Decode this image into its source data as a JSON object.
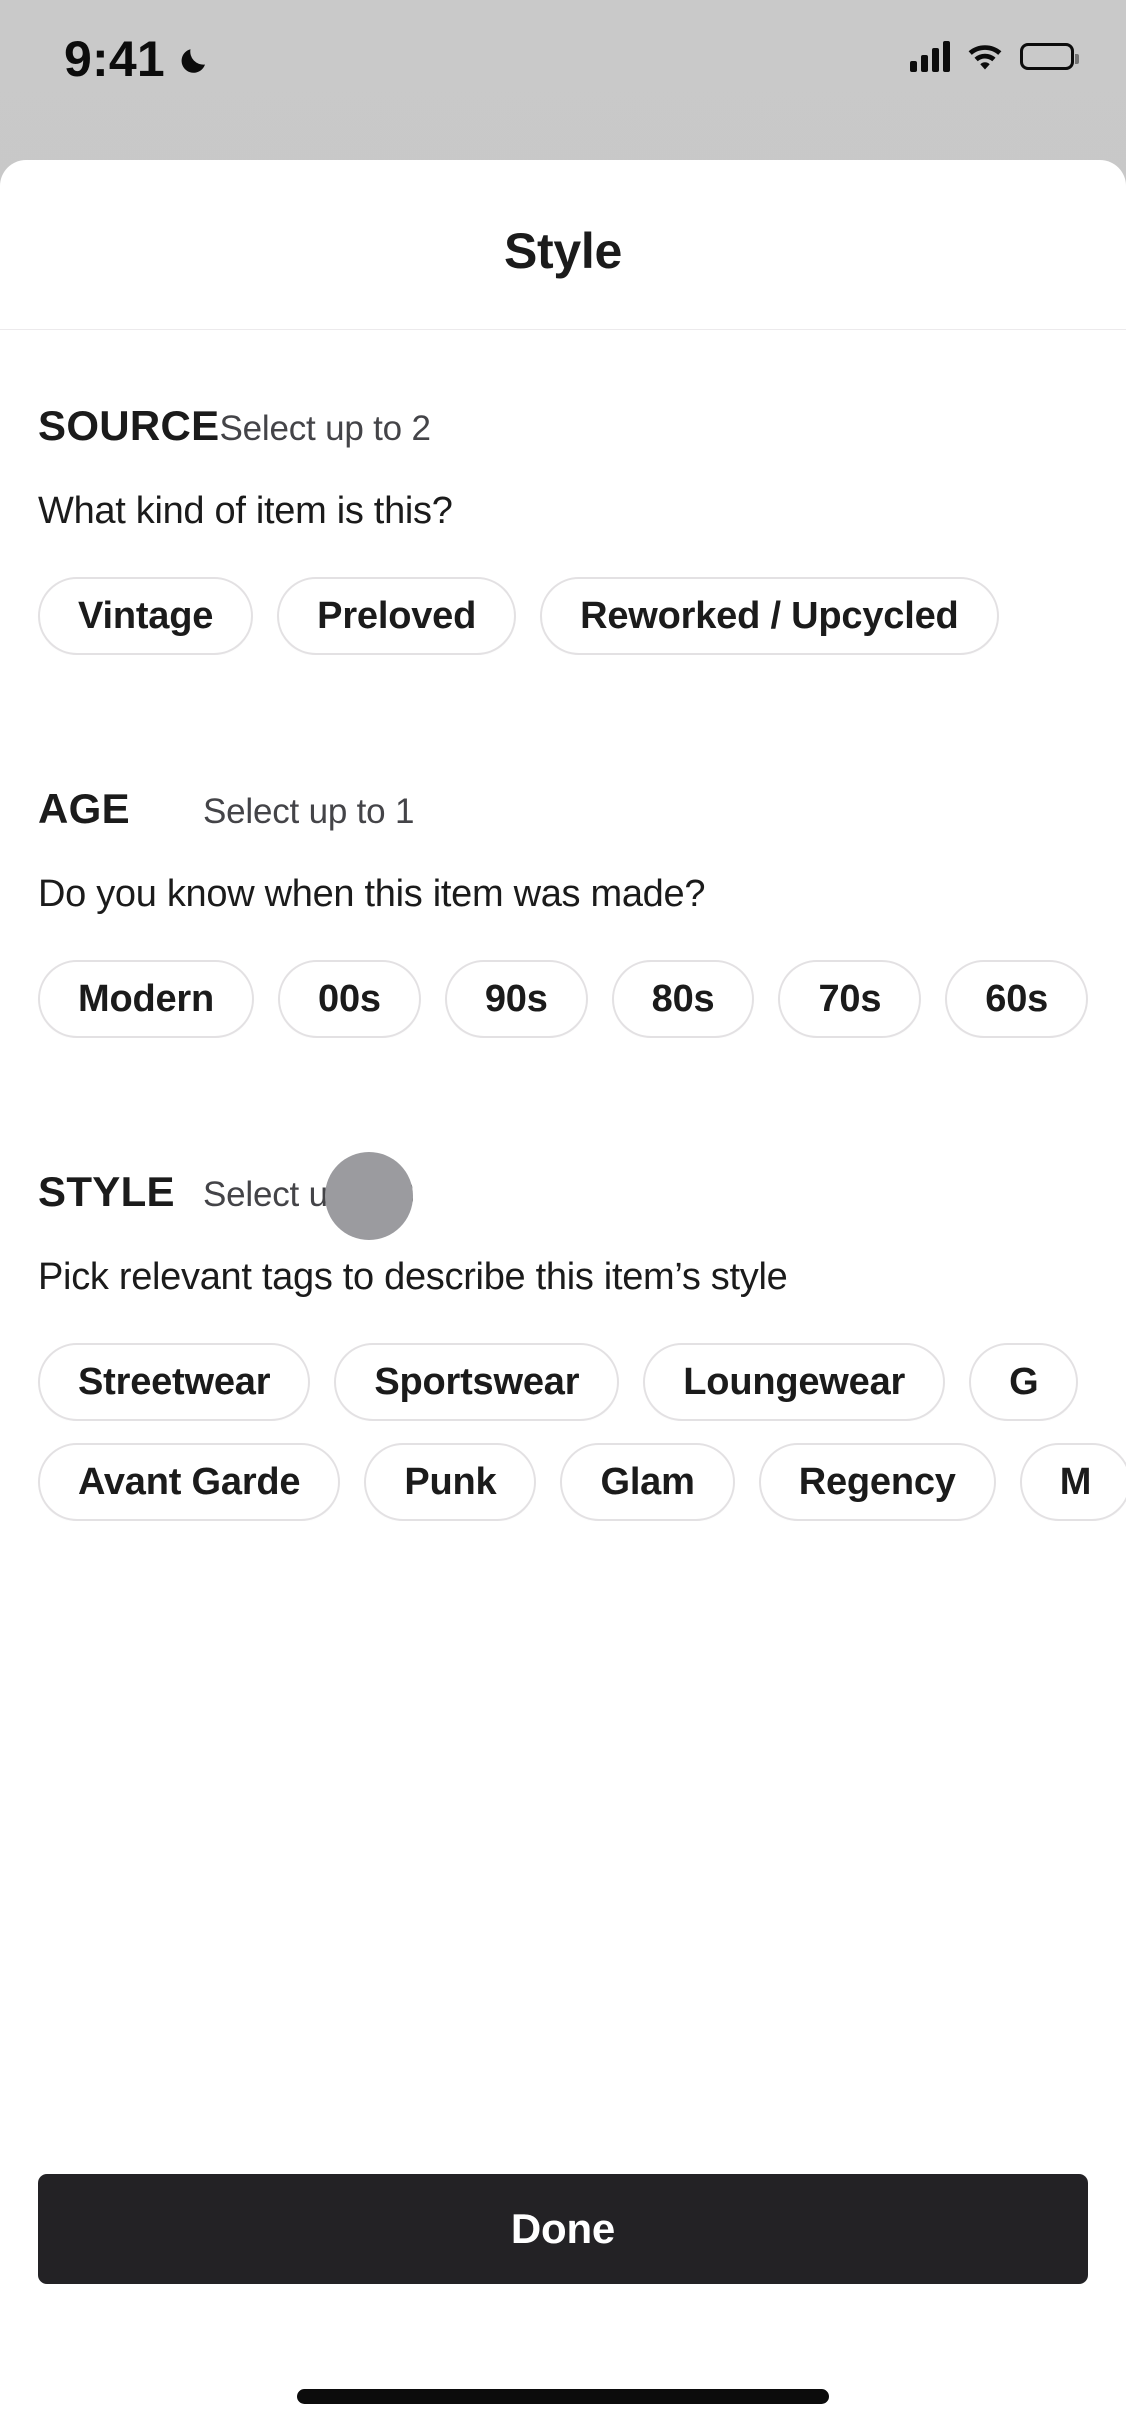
{
  "status_bar": {
    "time": "9:41",
    "dnd_icon": "moon-icon",
    "signal_icon": "cellular-signal-icon",
    "wifi_icon": "wifi-icon",
    "battery_icon": "battery-icon"
  },
  "header": {
    "title": "Style"
  },
  "sections": [
    {
      "id": "source",
      "title": "SOURCE",
      "hint": "Select up to 2",
      "question": "What kind of item is this?",
      "rows": [
        [
          "Vintage",
          "Preloved",
          "Reworked / Upcycled"
        ]
      ]
    },
    {
      "id": "age",
      "title": "AGE",
      "hint": "Select up to 1",
      "question": "Do you know when this item was made?",
      "rows": [
        [
          "Modern",
          "00s",
          "90s",
          "80s",
          "70s",
          "60s"
        ]
      ]
    },
    {
      "id": "style",
      "title": "STYLE",
      "hint": "Select up to 3",
      "question": "Pick relevant tags to describe this item’s style",
      "rows": [
        [
          "Streetwear",
          "Sportswear",
          "Loungewear",
          "G"
        ],
        [
          "Avant Garde",
          "Punk",
          "Glam",
          "Regency",
          "M"
        ]
      ]
    }
  ],
  "footer": {
    "done_label": "Done"
  },
  "overlay": {
    "touch_indicator": "touch-point-indicator"
  },
  "colors": {
    "button_background": "#232225",
    "button_text": "#ffffff",
    "chip_border": "#e3e1e3",
    "text_primary": "#1b1b1b",
    "text_secondary": "#444448",
    "touch_indicator": "#9b9b9f",
    "sheet_background": "#ffffff",
    "screen_background": "#c7c7c7"
  }
}
